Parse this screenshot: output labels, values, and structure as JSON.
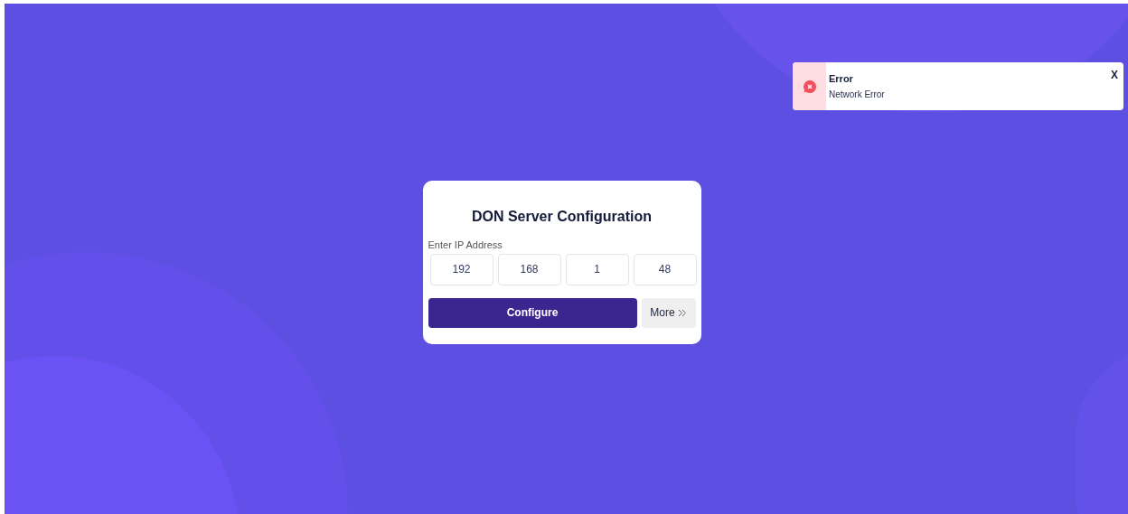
{
  "toast": {
    "title": "Error",
    "message": "Network Error",
    "close": "X"
  },
  "dialog": {
    "title": "DON Server Configuration",
    "ip_label": "Enter IP Address",
    "octets": [
      "192",
      "168",
      "1",
      "48"
    ],
    "configure_button": "Configure",
    "more_button": "More"
  }
}
